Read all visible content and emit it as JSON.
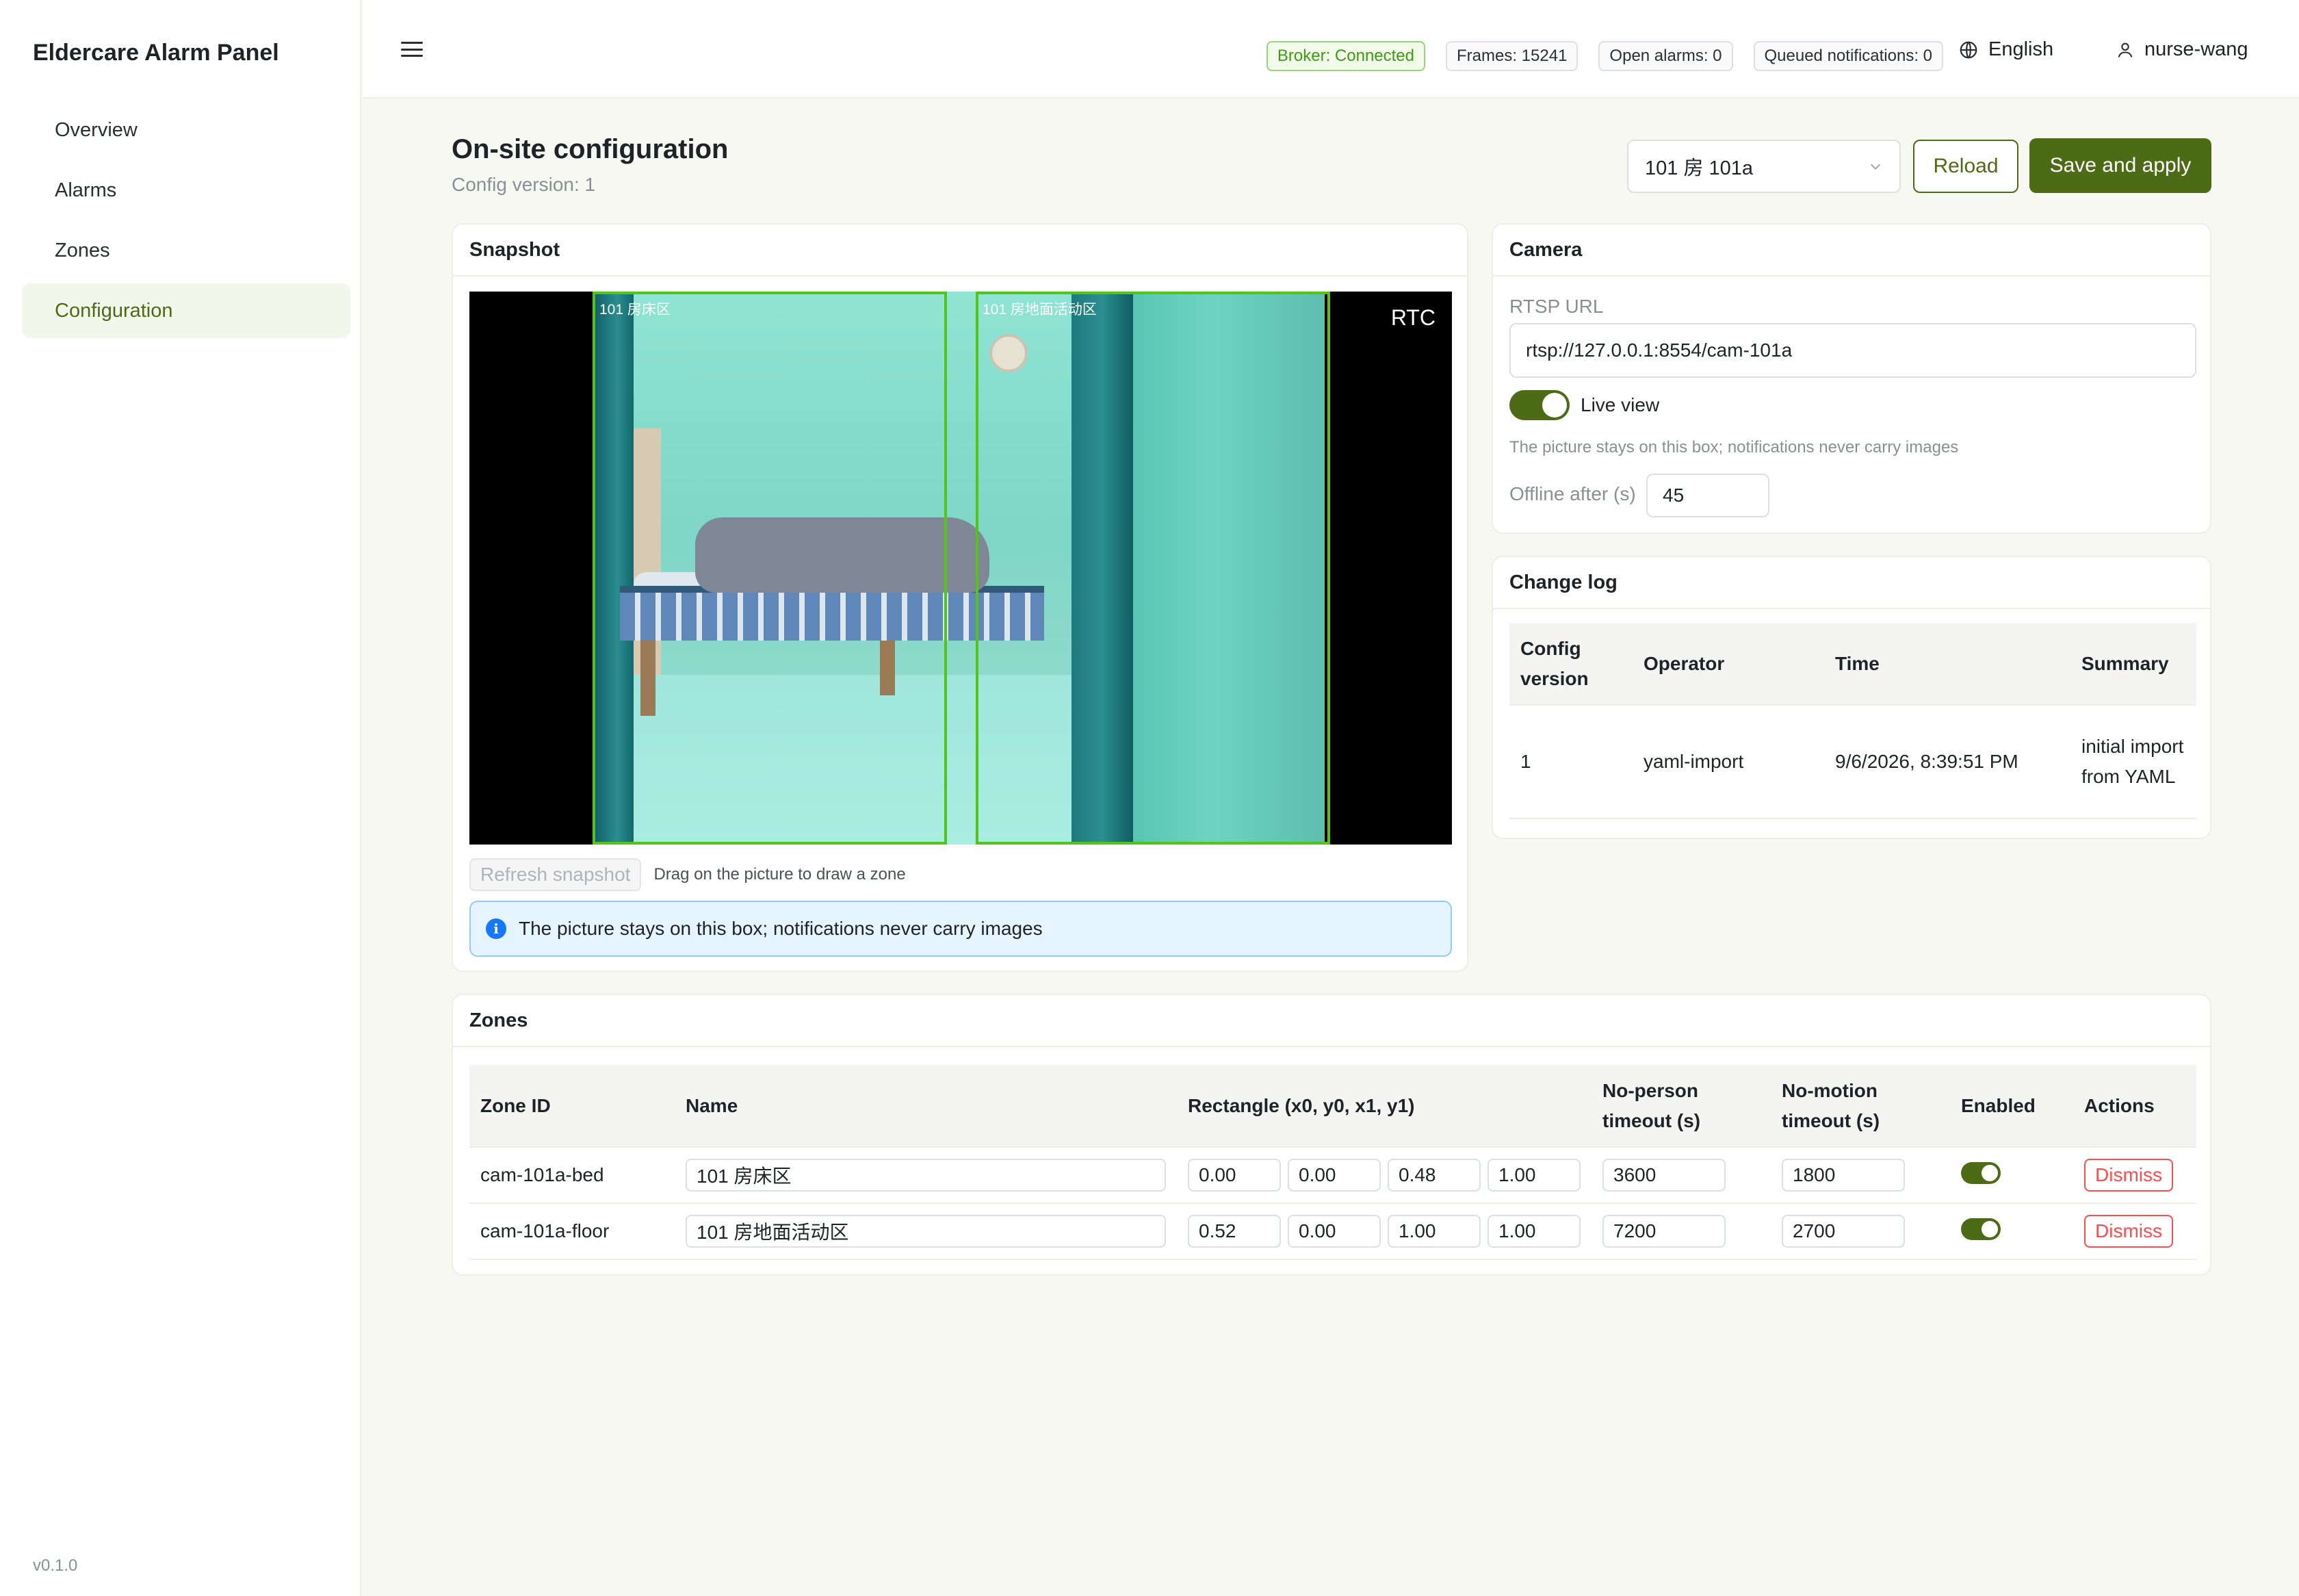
{
  "app": {
    "brand": "Eldercare Alarm Panel",
    "version": "v0.1.0"
  },
  "sidebar": {
    "items": [
      {
        "label": "Overview",
        "active": false
      },
      {
        "label": "Alarms",
        "active": false
      },
      {
        "label": "Zones",
        "active": false
      },
      {
        "label": "Configuration",
        "active": true
      }
    ]
  },
  "topbar": {
    "menu_icon": "hamburger-icon",
    "status": {
      "broker": "Broker: Connected",
      "frames": "Frames: 15241",
      "open_alarms": "Open alarms: 0",
      "queued": "Queued notifications: 0"
    },
    "language": "English",
    "language_icon": "globe-icon",
    "user": "nurse-wang",
    "user_icon": "user-icon"
  },
  "page": {
    "title": "On-site configuration",
    "subtitle": "Config version: 1",
    "camera_select": "101 房 101a",
    "reload_label": "Reload",
    "save_label": "Save and apply"
  },
  "snapshot": {
    "title": "Snapshot",
    "overlay": "RTC",
    "zones": [
      "101 房床区",
      "101 房地面活动区"
    ],
    "refresh_label": "Refresh snapshot",
    "hint": "Drag on the picture to draw a zone",
    "alert": "The picture stays on this box; notifications never carry images"
  },
  "camera": {
    "title": "Camera",
    "rtsp_label": "RTSP URL",
    "rtsp_value": "rtsp://127.0.0.1:8554/cam-101a",
    "live_view_label": "Live view",
    "live_view_on": true,
    "note": "The picture stays on this box; notifications never carry images",
    "offline_label": "Offline after (s)",
    "offline_value": "45"
  },
  "changelog": {
    "title": "Change log",
    "columns": [
      "Config version",
      "Operator",
      "Time",
      "Summary"
    ],
    "rows": [
      {
        "version": "1",
        "operator": "yaml-import",
        "time": "9/6/2026, 8:39:51 PM",
        "summary": "initial import from YAML"
      }
    ]
  },
  "zones": {
    "title": "Zones",
    "columns": [
      "Zone ID",
      "Name",
      "Rectangle (x0, y0, x1, y1)",
      "No-person timeout (s)",
      "No-motion timeout (s)",
      "Enabled",
      "Actions"
    ],
    "rows": [
      {
        "id": "cam-101a-bed",
        "name": "101 房床区",
        "rect": [
          "0.00",
          "0.00",
          "0.48",
          "1.00"
        ],
        "no_person": "3600",
        "no_motion": "1800",
        "enabled": true,
        "action": "Dismiss"
      },
      {
        "id": "cam-101a-floor",
        "name": "101 房地面活动区",
        "rect": [
          "0.52",
          "0.00",
          "1.00",
          "1.00"
        ],
        "no_person": "7200",
        "no_motion": "2700",
        "enabled": true,
        "action": "Dismiss"
      }
    ]
  },
  "colors": {
    "accent": "#4d6a14",
    "success": "#52c41a",
    "danger": "#ff4d4f",
    "info": "#1677ff"
  }
}
